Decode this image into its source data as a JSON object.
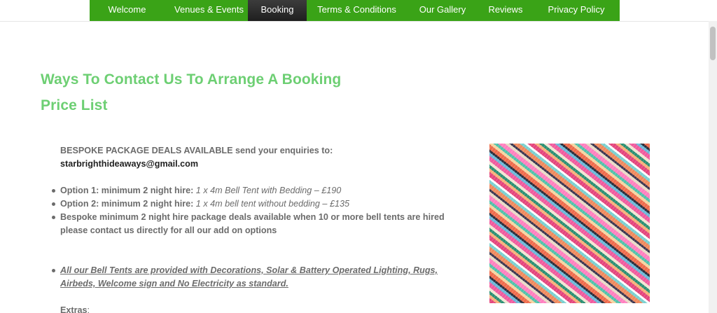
{
  "nav": {
    "items": [
      {
        "label": "Welcome"
      },
      {
        "label": "Venues & Events"
      },
      {
        "label": "Booking"
      },
      {
        "label": "Terms & Conditions"
      },
      {
        "label": "Our Gallery"
      },
      {
        "label": "Reviews"
      },
      {
        "label": "Privacy Policy"
      }
    ],
    "active_index": 2,
    "color": "#3aa317"
  },
  "headings": {
    "contact": "Ways To Contact Us To Arrange A Booking",
    "price_list": "Price List",
    "color": "#6dcf73"
  },
  "intro": {
    "bold": "BESPOKE PACKAGE DEALS AVAILABLE",
    "text": " send your enquiries to: ",
    "email": "starbrighthideaways@gmail.com"
  },
  "options": [
    {
      "label": "Option 1: minimum 2 night hire:",
      "detail": " 1 x 4m Bell Tent with Bedding – £190"
    },
    {
      "label": "Option 2: minimum 2 night hire:",
      "detail": "  1 x 4m bell tent without bedding – £135"
    },
    {
      "label": "Bespoke minimum 2 night hire package deals available when 10 or more bell tents are hired please contact us directly for all our add on options",
      "detail": ""
    }
  ],
  "standard_note": "All our Bell Tents are provided with Decorations, Solar & Battery Operated Lighting, Rugs, Airbeds, Welcome sign and No Electricity as standard. ",
  "extras": {
    "label": "Extras",
    "suffix": ":"
  },
  "image": {
    "icon": "rug-photo"
  }
}
